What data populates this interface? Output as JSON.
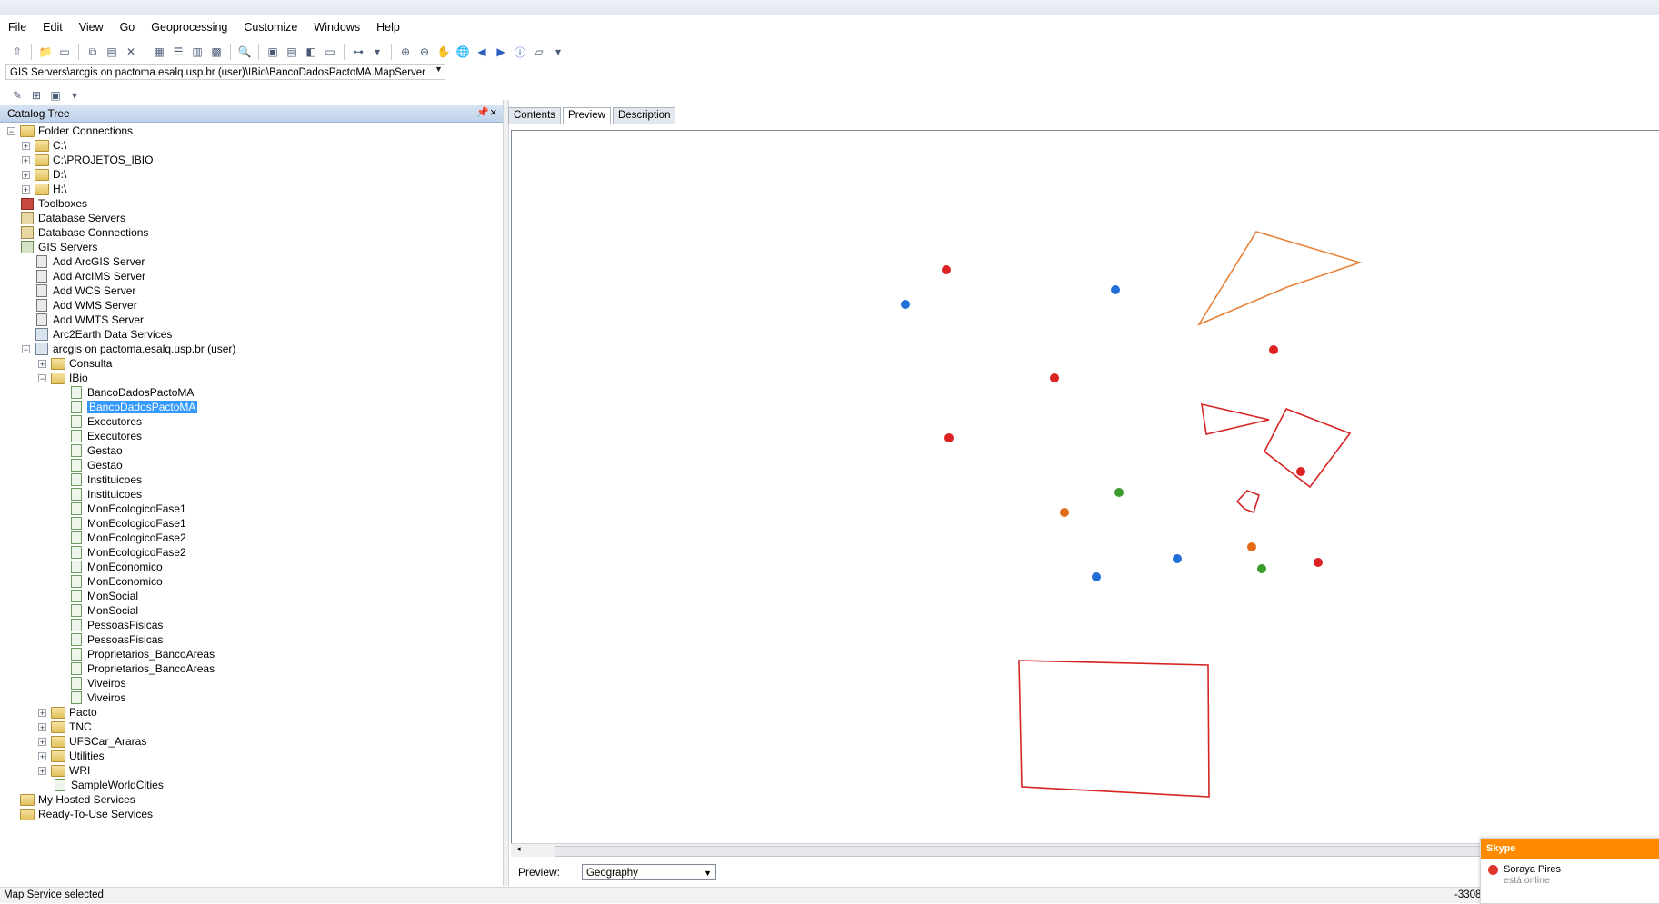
{
  "menu": [
    "File",
    "Edit",
    "View",
    "Go",
    "Geoprocessing",
    "Customize",
    "Windows",
    "Help"
  ],
  "location": {
    "value": "GIS Servers\\arcgis on pactoma.esalq.usp.br (user)\\IBio\\BancoDadosPactoMA.MapServer"
  },
  "catalog": {
    "title": "Catalog Tree"
  },
  "tree": {
    "folder_connections": "Folder Connections",
    "c_drive": "C:\\",
    "projetos": "C:\\PROJETOS_IBIO",
    "d_drive": "D:\\",
    "h_drive": "H:\\",
    "toolboxes": "Toolboxes",
    "database_servers": "Database Servers",
    "database_connections": "Database Connections",
    "gis_servers": "GIS Servers",
    "add_arcgis": "Add ArcGIS Server",
    "add_arcims": "Add ArcIMS Server",
    "add_wcs": "Add WCS Server",
    "add_wms": "Add WMS Server",
    "add_wmts": "Add WMTS Server",
    "arc2earth": "Arc2Earth Data Services",
    "arcgis_pactoma": "arcgis on pactoma.esalq.usp.br (user)",
    "consulta": "Consulta",
    "ibio": "IBio",
    "ibio_items": [
      "BancoDadosPactoMA",
      "BancoDadosPactoMA",
      "Executores",
      "Executores",
      "Gestao",
      "Gestao",
      "Instituicoes",
      "Instituicoes",
      "MonEcologicoFase1",
      "MonEcologicoFase1",
      "MonEcologicoFase2",
      "MonEcologicoFase2",
      "MonEconomico",
      "MonEconomico",
      "MonSocial",
      "MonSocial",
      "PessoasFisicas",
      "PessoasFisicas",
      "Proprietarios_BancoAreas",
      "Proprietarios_BancoAreas",
      "Viveiros",
      "Viveiros"
    ],
    "pacto": "Pacto",
    "tnc": "TNC",
    "ufscar": "UFSCar_Araras",
    "utilities": "Utilities",
    "wri": "WRI",
    "sampleworldcities": "SampleWorldCities",
    "my_hosted": "My Hosted Services",
    "ready_to_use": "Ready-To-Use Services"
  },
  "tabs": [
    "Contents",
    "Preview",
    "Description"
  ],
  "preview": {
    "label": "Preview:",
    "selected": "Geography"
  },
  "map": {
    "colors": {
      "red": "#dd2222",
      "blue": "#1f6fd6",
      "green": "#3a9a2a",
      "orange": "#e36b18",
      "polygon_orange": "#e8823a",
      "polygon_red": "#d62424"
    }
  },
  "status": {
    "message": "Map Service selected",
    "coords": "-3308"
  },
  "skype": {
    "brand": "Skype",
    "contact": "Soraya Pires",
    "state": "está online"
  }
}
